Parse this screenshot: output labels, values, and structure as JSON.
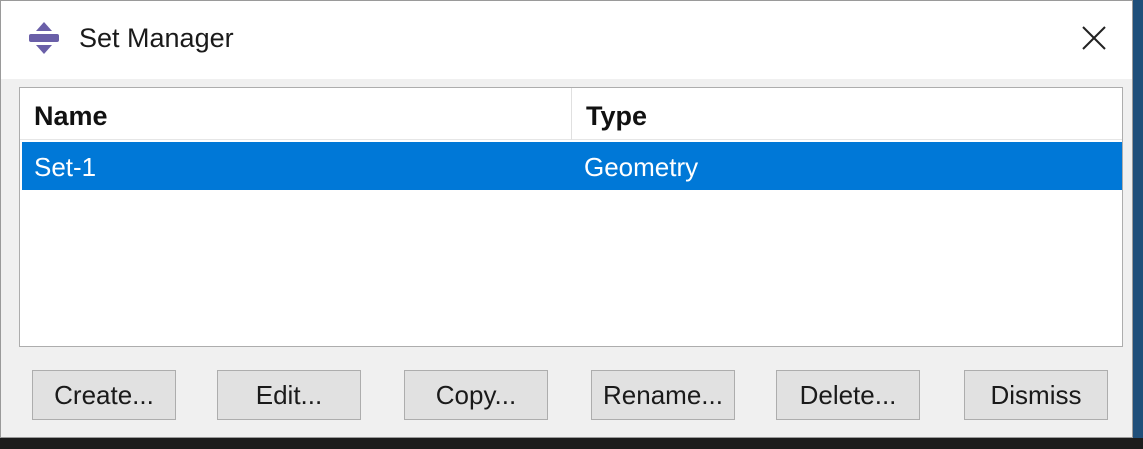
{
  "window": {
    "title": "Set Manager",
    "app_icon": "abaqus-app-icon",
    "close_icon": "close-icon"
  },
  "table": {
    "columns": [
      "Name",
      "Type"
    ],
    "rows": [
      {
        "name": "Set-1",
        "type": "Geometry",
        "selected": true
      }
    ],
    "selection_color": "#0078d7"
  },
  "buttons": {
    "create": "Create...",
    "edit": "Edit...",
    "copy": "Copy...",
    "rename": "Rename...",
    "delete": "Delete...",
    "dismiss": "Dismiss"
  }
}
